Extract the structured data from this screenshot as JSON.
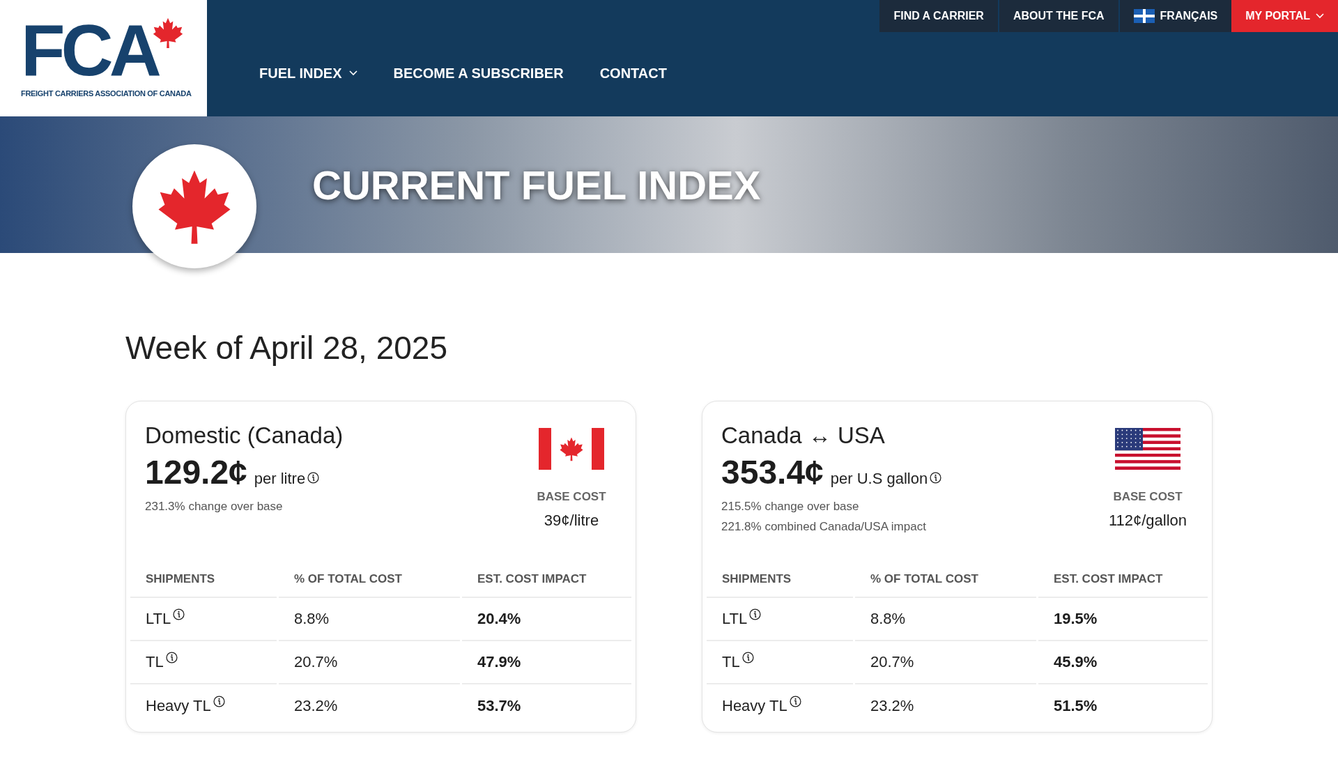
{
  "header": {
    "logo": {
      "mark": "FCA",
      "tagline": "FREIGHT CARRIERS ASSOCIATION OF CANADA"
    },
    "utility_links": [
      {
        "label": "FIND A CARRIER",
        "kind": "link"
      },
      {
        "label": "ABOUT THE FCA",
        "kind": "link"
      },
      {
        "label": "FRANÇAIS",
        "kind": "language"
      },
      {
        "label": "MY PORTAL",
        "kind": "portal"
      }
    ],
    "nav": [
      {
        "label": "FUEL INDEX",
        "has_dropdown": true
      },
      {
        "label": "BECOME A SUBSCRIBER",
        "has_dropdown": false
      },
      {
        "label": "CONTACT",
        "has_dropdown": false
      }
    ]
  },
  "hero": {
    "title": "CURRENT FUEL INDEX"
  },
  "week": "Week of April 28, 2025",
  "cards": [
    {
      "title": "Domestic (Canada)",
      "kind": "canada",
      "price": "129.2¢",
      "unit": "per litre",
      "notes": [
        "231.3% change over base"
      ],
      "base_cost_label": "BASE COST",
      "base_cost": "39¢/litre",
      "columns": [
        "SHIPMENTS",
        "% OF TOTAL COST",
        "EST. COST IMPACT"
      ],
      "rows": [
        {
          "shipment": "LTL",
          "share": "8.8%",
          "impact": "20.4%"
        },
        {
          "shipment": "TL",
          "share": "20.7%",
          "impact": "47.9%"
        },
        {
          "shipment": "Heavy TL",
          "share": "23.2%",
          "impact": "53.7%"
        }
      ]
    },
    {
      "title": "Canada ↔ USA",
      "kind": "usa",
      "price": "353.4¢",
      "unit": "per U.S gallon",
      "notes": [
        "215.5% change over base",
        "221.8% combined Canada/USA impact"
      ],
      "base_cost_label": "BASE COST",
      "base_cost": "112¢/gallon",
      "columns": [
        "SHIPMENTS",
        "% OF TOTAL COST",
        "EST. COST IMPACT"
      ],
      "rows": [
        {
          "shipment": "LTL",
          "share": "8.8%",
          "impact": "19.5%"
        },
        {
          "shipment": "TL",
          "share": "20.7%",
          "impact": "45.9%"
        },
        {
          "shipment": "Heavy TL",
          "share": "23.2%",
          "impact": "51.5%"
        }
      ]
    }
  ]
}
